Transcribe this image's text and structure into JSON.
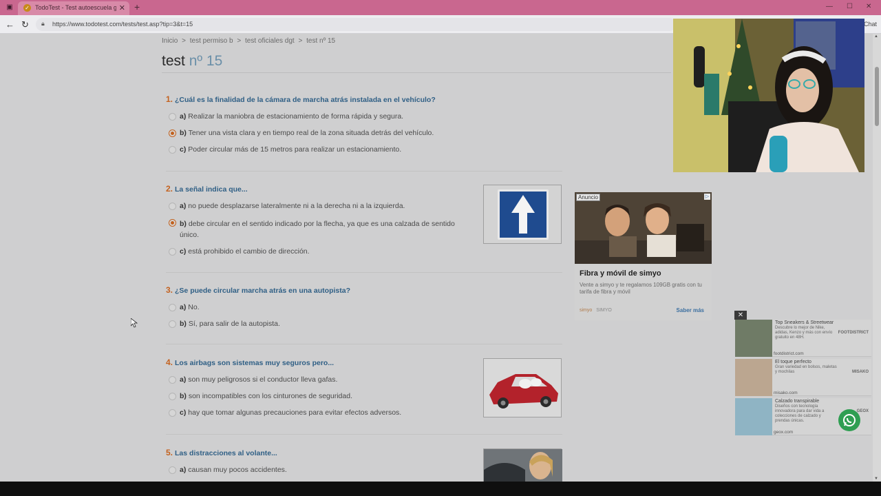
{
  "browser": {
    "tab_title": "TodoTest - Test autoescuela grati",
    "url": "https://www.todotest.com/tests/test.asp?tip=3&t=15",
    "sidebar_label": "Chat"
  },
  "breadcrumb": [
    "Inicio",
    ">",
    "test permiso b",
    ">",
    "test oficiales dgt",
    ">",
    "test nº 15"
  ],
  "page_title": {
    "word": "test",
    "number": "nº 15"
  },
  "questions": [
    {
      "num": "1.",
      "text": "¿Cuál es la finalidad de la cámara de marcha atrás instalada en el vehículo?",
      "options": [
        {
          "letter": "a)",
          "text": "Realizar la maniobra de estacionamiento de forma rápida y segura."
        },
        {
          "letter": "b)",
          "text": "Tener una vista clara y en tiempo real de la zona situada detrás del vehículo."
        },
        {
          "letter": "c)",
          "text": "Poder circular más de 15 metros para realizar un estacionamiento."
        }
      ]
    },
    {
      "num": "2.",
      "text": "La señal indica que...",
      "options": [
        {
          "letter": "a)",
          "text": "no puede desplazarse lateralmente ni a la derecha ni a la izquierda."
        },
        {
          "letter": "b)",
          "text": "debe circular en el sentido indicado por la flecha, ya que es una calzada de sentido único."
        },
        {
          "letter": "c)",
          "text": "está prohibido el cambio de dirección."
        }
      ]
    },
    {
      "num": "3.",
      "text": "¿Se puede circular marcha atrás en una autopista?",
      "options": [
        {
          "letter": "a)",
          "text": "No."
        },
        {
          "letter": "b)",
          "text": "Sí, para salir de la autopista."
        }
      ]
    },
    {
      "num": "4.",
      "text": "Los airbags son sistemas muy seguros pero...",
      "options": [
        {
          "letter": "a)",
          "text": "son muy peligrosos si el conductor lleva gafas."
        },
        {
          "letter": "b)",
          "text": "son incompatibles con los cinturones de seguridad."
        },
        {
          "letter": "c)",
          "text": "hay que tomar algunas precauciones para evitar efectos adversos."
        }
      ]
    },
    {
      "num": "5.",
      "text": "Las distracciones al volante...",
      "options": [
        {
          "letter": "a)",
          "text": "causan muy pocos accidentes."
        }
      ]
    }
  ],
  "ad": {
    "badge": "Anuncio",
    "headline": "Fibra y móvil de simyo",
    "body": "Vente a simyo y te regalamos 109GB gratis con tu tarifa de fibra y móvil",
    "brand_logo": "simyo",
    "brand": "SIMYO",
    "cta": "Saber más"
  },
  "side_ads": [
    {
      "title": "Top Sneakers & Streetwear",
      "desc": "Descubre lo mejor de Nike, adidas, Kenzo y más con envío gratuito en 48H.",
      "domain": "footdistrict.com",
      "logo": "FOOTDISTRICT"
    },
    {
      "title": "El toque perfecto",
      "desc": "Gran variedad en bolsos, maletas y mochilas",
      "domain": "misako.com",
      "logo": "MISAKO"
    },
    {
      "title": "Calzado transpirable",
      "desc": "Diseños con tecnología innovadora para dar vida a colecciones de calzado y prendas únicas.",
      "domain": "geox.com",
      "logo": "GEOX"
    }
  ],
  "colors": {
    "accent_orange": "#c4621f",
    "link_blue": "#2f5f85",
    "sign_blue": "#1f4b8f"
  },
  "icons": [
    "windows-icon",
    "close-icon",
    "plus-icon",
    "back-arrow-icon",
    "reload-icon",
    "lock-icon",
    "radio-icon",
    "whatsapp-icon",
    "ad-choices-icon",
    "cursor-icon"
  ]
}
